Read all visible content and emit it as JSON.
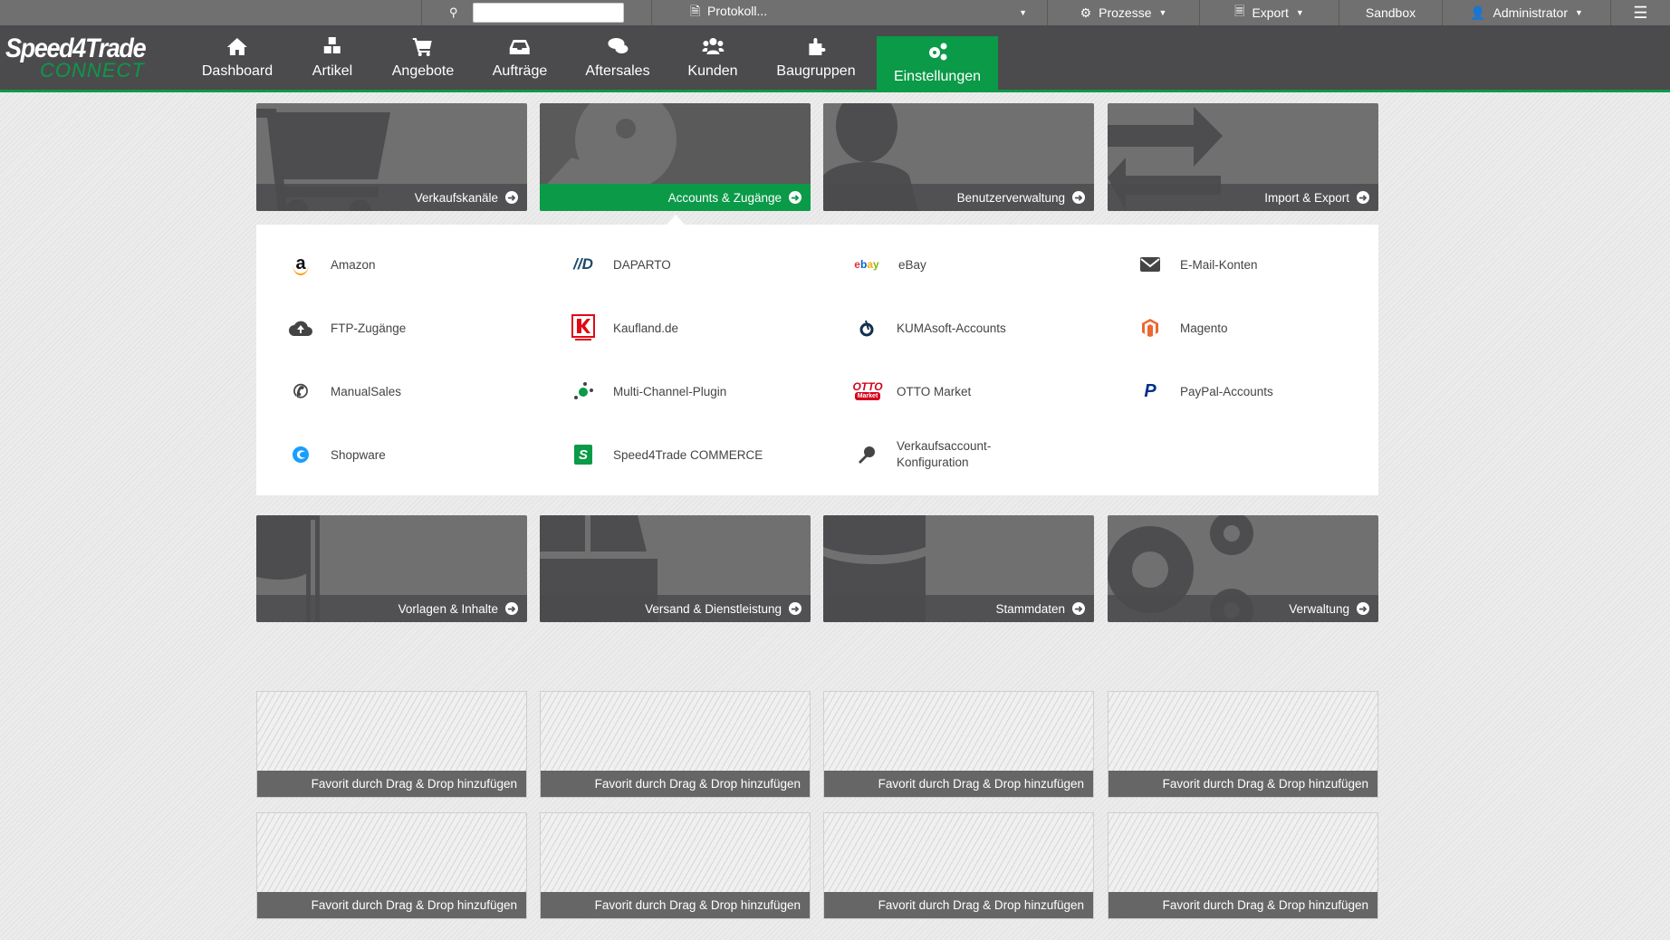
{
  "topbar": {
    "search_placeholder": "",
    "protokoll": "Protokoll...",
    "prozesse": "Prozesse",
    "export": "Export",
    "sandbox": "Sandbox",
    "user": "Administrator"
  },
  "logo": {
    "line1": "Speed4Trade",
    "line2": "CONNECT"
  },
  "nav": [
    "Dashboard",
    "Artikel",
    "Angebote",
    "Aufträge",
    "Aftersales",
    "Kunden",
    "Baugruppen",
    "Einstellungen"
  ],
  "active_nav": "Einstellungen",
  "tiles_top": [
    "Verkaufskanäle",
    "Accounts & Zugänge",
    "Benutzerverwaltung",
    "Import & Export"
  ],
  "active_tile": "Accounts & Zugänge",
  "panel_items": [
    "Amazon",
    "DAPARTO",
    "eBay",
    "E-Mail-Konten",
    "FTP-Zugänge",
    "Kaufland.de",
    "KUMAsoft-Accounts",
    "Magento",
    "ManualSales",
    "Multi-Channel-Plugin",
    "OTTO Market",
    "PayPal-Accounts",
    "Shopware",
    "Speed4Trade COMMERCE",
    "Verkaufsaccount-Konfiguration"
  ],
  "tiles_bottom": [
    "Vorlagen & Inhalte",
    "Versand & Dienstleistung",
    "Stammdaten",
    "Verwaltung"
  ],
  "favorite_label": "Favorit durch Drag & Drop hinzufügen",
  "colors": {
    "accent": "#0a9a48",
    "nav_bg": "#4b4b4d",
    "topbar_bg": "#707070"
  }
}
